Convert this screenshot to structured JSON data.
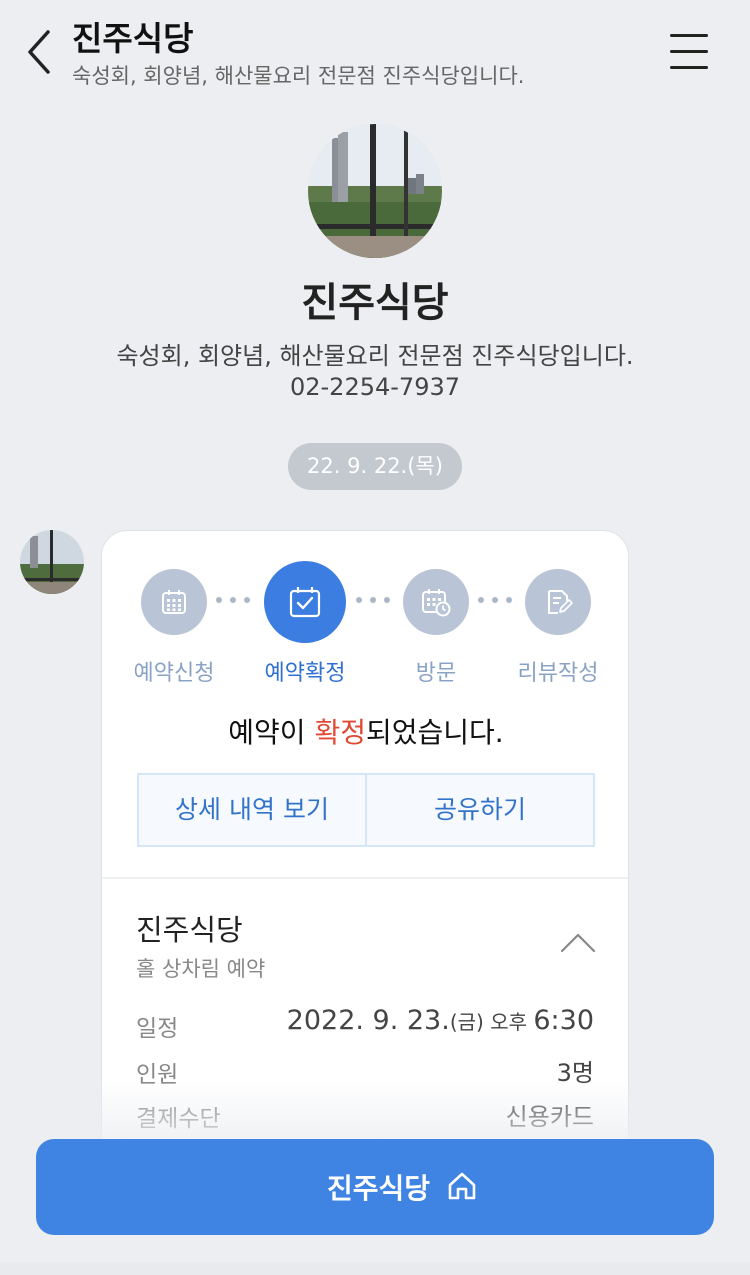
{
  "header": {
    "title": "진주식당",
    "subtitle": "숙성회, 회양념, 해산물요리 전문점 진주식당입니다."
  },
  "profile": {
    "name": "진주식당",
    "description": "숙성회, 회양념, 해산물요리 전문점 진주식당입니다.",
    "phone": "02-2254-7937"
  },
  "date_label": "22. 9. 22.(목)",
  "card": {
    "steps": [
      {
        "label": "예약신청",
        "icon": "calendar-icon",
        "active": false
      },
      {
        "label": "예약확정",
        "icon": "calendar-check-icon",
        "active": true
      },
      {
        "label": "방문",
        "icon": "calendar-clock-icon",
        "active": false
      },
      {
        "label": "리뷰작성",
        "icon": "edit-note-icon",
        "active": false
      }
    ],
    "status_prefix": "예약이 ",
    "status_highlight": "확정",
    "status_suffix": "되었습니다.",
    "detail_button": "상세 내역 보기",
    "share_button": "공유하기",
    "restaurant_name": "진주식당",
    "reservation_type": "홀 상차림 예약",
    "info": {
      "schedule_label": "일정",
      "schedule_date": "2022. 9. 23.",
      "schedule_day": "(금)",
      "schedule_ampm": " 오후 ",
      "schedule_time": "6:30",
      "people_label": "인원",
      "people_value": "3명",
      "payment_label": "결제수단",
      "payment_value": "신용카드"
    }
  },
  "bottom_button": {
    "label": "진주식당",
    "icon": "home-icon"
  },
  "colors": {
    "accent": "#3b7de0",
    "highlight": "#e04a35",
    "inactive_step": "#b9c5d6",
    "background": "#eceef1"
  }
}
